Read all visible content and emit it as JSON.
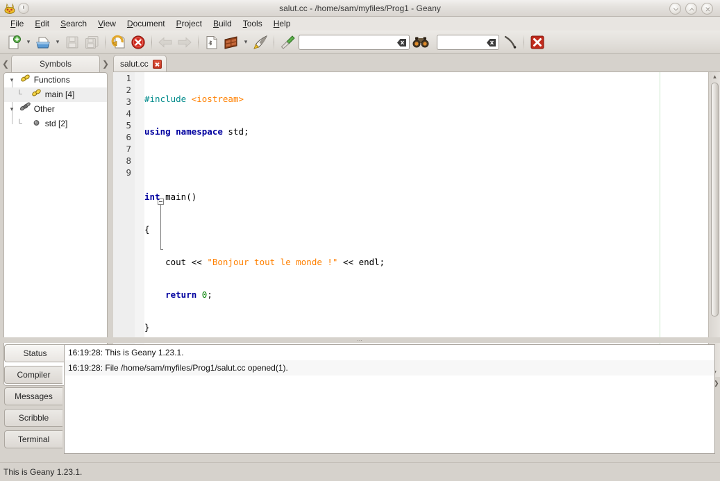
{
  "window": {
    "title": "salut.cc - /home/sam/myfiles/Prog1 - Geany",
    "app_icon": "geany-icon",
    "buttons": {
      "minimize": "minimize-icon",
      "maximize": "maximize-icon",
      "close": "close-icon"
    }
  },
  "menubar": {
    "items": [
      {
        "label": "File",
        "mnemonic": "F"
      },
      {
        "label": "Edit",
        "mnemonic": "E"
      },
      {
        "label": "Search",
        "mnemonic": "S"
      },
      {
        "label": "View",
        "mnemonic": "V"
      },
      {
        "label": "Document",
        "mnemonic": "D"
      },
      {
        "label": "Project",
        "mnemonic": "P"
      },
      {
        "label": "Build",
        "mnemonic": "B"
      },
      {
        "label": "Tools",
        "mnemonic": "T"
      },
      {
        "label": "Help",
        "mnemonic": "H"
      }
    ]
  },
  "toolbar": {
    "buttons": [
      {
        "name": "new-file-button",
        "icon": "new-document-icon",
        "enabled": true
      },
      {
        "name": "new-file-menu-button",
        "icon": "chevron-down-icon",
        "enabled": true
      },
      {
        "name": "open-file-button",
        "icon": "open-folder-icon",
        "enabled": true
      },
      {
        "name": "open-file-menu-button",
        "icon": "chevron-down-icon",
        "enabled": true
      },
      {
        "name": "save-button",
        "icon": "floppy-save-icon",
        "enabled": false
      },
      {
        "name": "save-all-button",
        "icon": "save-all-icon",
        "enabled": false
      },
      {
        "name": "revert-button",
        "icon": "revert-arrow-icon",
        "enabled": true
      },
      {
        "name": "close-button",
        "icon": "close-circle-icon",
        "enabled": true
      },
      {
        "name": "back-button",
        "icon": "arrow-left-icon",
        "enabled": false
      },
      {
        "name": "forward-button",
        "icon": "arrow-right-icon",
        "enabled": false
      },
      {
        "name": "compile-button",
        "icon": "compile-page-icon",
        "enabled": true
      },
      {
        "name": "build-button",
        "icon": "build-brick-icon",
        "enabled": true
      },
      {
        "name": "build-menu-button",
        "icon": "chevron-down-icon",
        "enabled": true
      },
      {
        "name": "run-button",
        "icon": "rocket-run-icon",
        "enabled": true
      },
      {
        "name": "color-picker-button",
        "icon": "color-dropper-icon",
        "enabled": true
      },
      {
        "name": "jump-to-button",
        "icon": "jump-arrow-icon",
        "enabled": true
      },
      {
        "name": "quit-button",
        "icon": "quit-x-icon",
        "enabled": true
      }
    ],
    "search_entry": {
      "value": "",
      "placeholder": "",
      "clear_icon": "clear-entry-icon"
    },
    "find_icon": "binoculars-icon",
    "goto_entry": {
      "value": "",
      "placeholder": "",
      "clear_icon": "clear-entry-icon"
    }
  },
  "sidebar": {
    "tab_label": "Symbols",
    "prev_arrow_icon": "chevron-left-icon",
    "next_arrow_icon": "chevron-right-icon",
    "tree": [
      {
        "label": "Functions",
        "icon": "function-link-icon",
        "depth": 0,
        "expanded": true,
        "selected": false
      },
      {
        "label": "main [4]",
        "icon": "function-link-icon",
        "depth": 1,
        "expanded": null,
        "selected": true
      },
      {
        "label": "Other",
        "icon": "other-links-icon",
        "depth": 0,
        "expanded": true,
        "selected": false
      },
      {
        "label": "std [2]",
        "icon": "namespace-dot-icon",
        "depth": 1,
        "expanded": null,
        "selected": false
      }
    ]
  },
  "editor": {
    "tab_label": "salut.cc",
    "tab_close_icon": "close-icon",
    "long_line_marker_color": "#c9e8c9",
    "gutter_background": "#eeeeee",
    "line_numbers": [
      "1",
      "2",
      "3",
      "4",
      "5",
      "6",
      "7",
      "8",
      "9"
    ],
    "lines": [
      [
        {
          "t": "#include ",
          "c": "pp"
        },
        {
          "t": "<iostream>",
          "c": "hd"
        }
      ],
      [
        {
          "t": "using namespace ",
          "c": "k"
        },
        {
          "t": "std;",
          "c": ""
        }
      ],
      [],
      [
        {
          "t": "int ",
          "c": "k"
        },
        {
          "t": "main()",
          "c": ""
        }
      ],
      [
        {
          "t": "{",
          "c": ""
        }
      ],
      [
        {
          "t": "    cout << ",
          "c": ""
        },
        {
          "t": "\"Bonjour tout le monde !\"",
          "c": "st"
        },
        {
          "t": " << endl;",
          "c": ""
        }
      ],
      [
        {
          "t": "    ",
          "c": ""
        },
        {
          "t": "return ",
          "c": "k"
        },
        {
          "t": "0",
          "c": "nm"
        },
        {
          "t": ";",
          "c": ""
        }
      ],
      [
        {
          "t": "}",
          "c": ""
        }
      ],
      []
    ],
    "fold_marker_icon": "fold-collapse-icon",
    "vscroll_up_icon": "chevron-up-icon",
    "vscroll_down_icon": "chevron-down-icon",
    "hscroll_left_icon": "chevron-left-icon",
    "corner_icon": "resize-grip-icon",
    "syntax_colors": {
      "keyword": "#00009f",
      "preprocessor": "#008b8b",
      "string": "#ff8000",
      "include_header": "#ff8000",
      "number": "#008000",
      "text": "#000000"
    }
  },
  "messages": {
    "tabs": [
      {
        "label": "Status",
        "active": true
      },
      {
        "label": "Compiler",
        "active": false
      },
      {
        "label": "Messages",
        "active": false
      },
      {
        "label": "Scribble",
        "active": false
      },
      {
        "label": "Terminal",
        "active": false
      }
    ],
    "lines": [
      {
        "time": "16:19:28:",
        "text": "This is Geany 1.23.1."
      },
      {
        "time": "16:19:28:",
        "text": "File /home/sam/myfiles/Prog1/salut.cc opened(1)."
      }
    ]
  },
  "statusbar": {
    "text": "This is Geany 1.23.1."
  }
}
